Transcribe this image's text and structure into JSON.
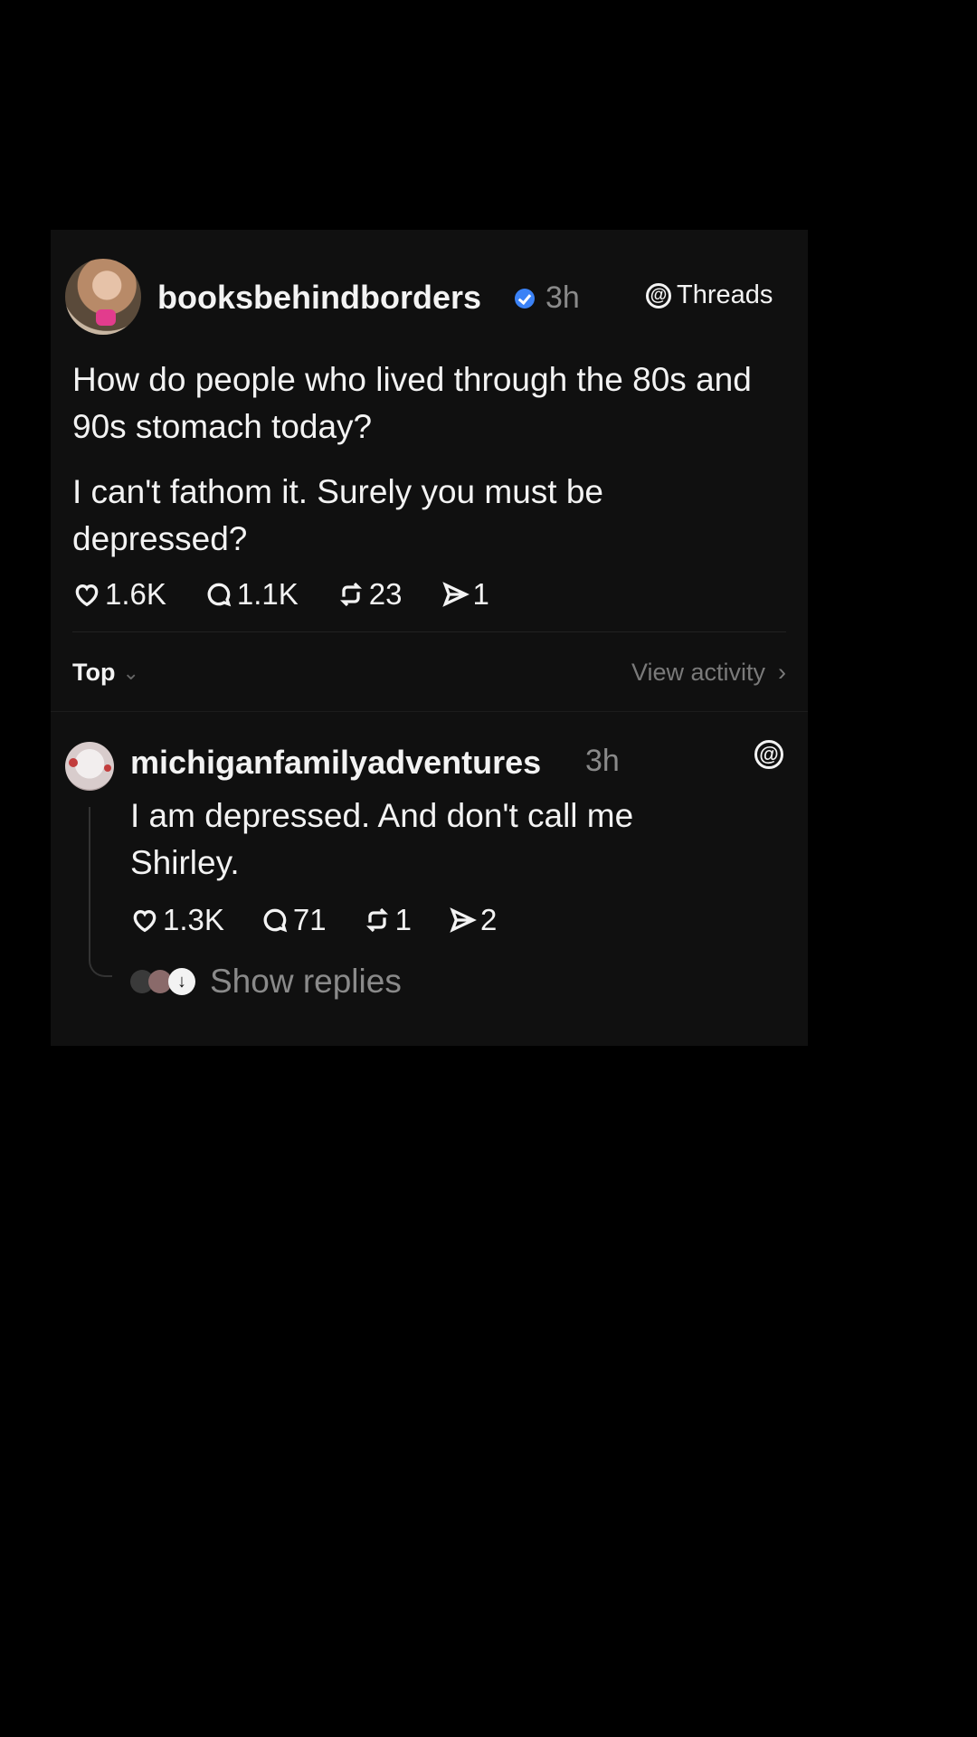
{
  "post": {
    "username": "booksbehindborders",
    "time": "3h",
    "platform": "Threads",
    "paragraphs": [
      "How do people who lived through the 80s and 90s stomach today?",
      "I can't fathom it. Surely you must be depressed?"
    ],
    "likes": "1.6K",
    "comments": "1.1K",
    "reposts": "23",
    "shares": "1"
  },
  "sort": {
    "label": "Top",
    "view_activity": "View activity"
  },
  "reply": {
    "username": "michiganfamilyadventures",
    "time": "3h",
    "text": "I am depressed. And don't call me Shirley.",
    "likes": "1.3K",
    "comments": "71",
    "reposts": "1",
    "shares": "2",
    "show_replies": "Show replies"
  },
  "icons": [
    "heart-icon",
    "comment-icon",
    "repost-icon",
    "share-icon",
    "threads-icon",
    "verified-icon",
    "chevron-down-icon",
    "chevron-right-icon",
    "arrow-down-icon"
  ],
  "colors": {
    "background": "#000000",
    "card": "#101010",
    "text": "#f3f3f3",
    "muted": "#8a8a8a",
    "verified": "#3b82f6"
  }
}
